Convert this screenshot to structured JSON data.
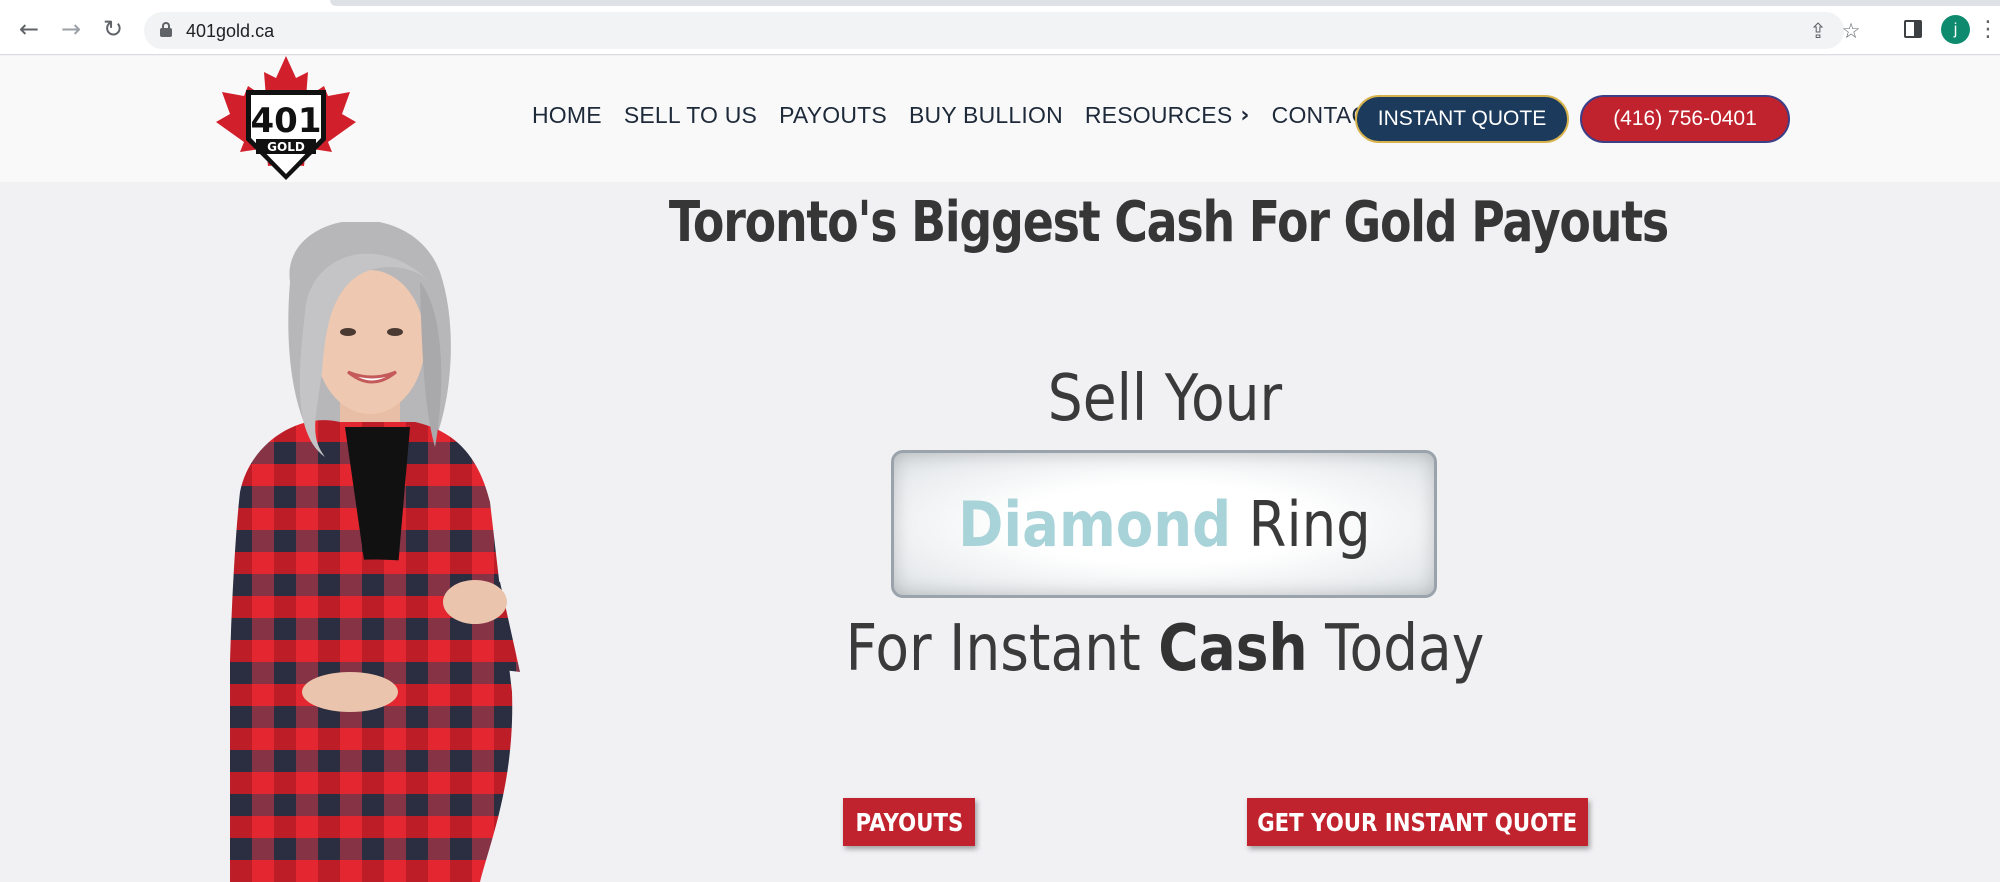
{
  "browser": {
    "url": "401gold.ca",
    "profile_initial": "j",
    "icons": [
      "back-arrow-icon",
      "forward-arrow-icon",
      "reload-icon",
      "lock-icon",
      "share-icon",
      "bookmark-star-icon",
      "side-panel-icon",
      "menu-dots-icon"
    ]
  },
  "header": {
    "logo": {
      "number": "401",
      "word": "GOLD"
    },
    "menu": [
      {
        "label": "HOME"
      },
      {
        "label": "SELL TO US"
      },
      {
        "label": "PAYOUTS"
      },
      {
        "label": "BUY BULLION"
      },
      {
        "label": "RESOURCES",
        "has_submenu": true
      },
      {
        "label": "CONTACT"
      }
    ],
    "instant_quote_label": "INSTANT QUOTE",
    "phone_label": "(416) 756-0401"
  },
  "hero": {
    "title": "Toronto's Biggest Cash For Gold Payouts",
    "sell_your": "Sell Your",
    "rotator_item": "Diamond",
    "rotator_noun": "Ring",
    "instant_prefix": "For Instant",
    "instant_bold": "Cash",
    "instant_suffix": "Today",
    "cta_payouts": "PAYOUTS",
    "cta_quote": "GET YOUR INSTANT QUOTE"
  },
  "colors": {
    "brand_red": "#c1232e",
    "brand_navy": "#1b3a5c",
    "rotator_accent": "#a8d3d9",
    "text_dark": "#363636"
  }
}
